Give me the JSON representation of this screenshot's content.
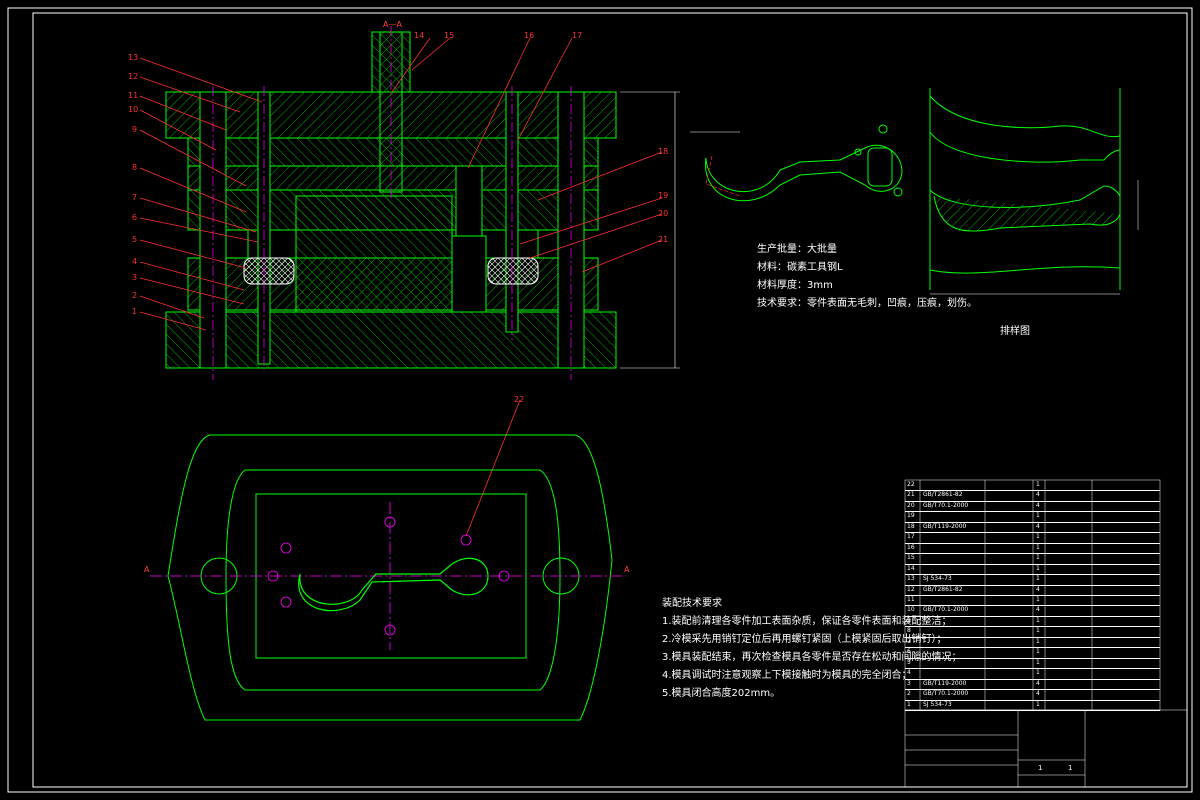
{
  "colors": {
    "background": "#000000",
    "outline": "#00ff00",
    "hatch": "#00cc00",
    "leader": "#ff2020",
    "center": "#ff00ff",
    "text": "#ffffff",
    "frame": "#ffffff"
  },
  "section_label": "A—A",
  "part_numbers": [
    "1",
    "2",
    "3",
    "4",
    "5",
    "6",
    "7",
    "8",
    "9",
    "10",
    "11",
    "12",
    "13",
    "14",
    "15",
    "16",
    "17",
    "18",
    "19",
    "20",
    "21",
    "22"
  ],
  "strip_label": "排样图",
  "spec": {
    "line1": "生产批量：大批量",
    "line2": "材料：碳素工具钢L",
    "line3": "材料厚度：3mm",
    "line4": "技术要求：零件表面无毛刺，凹痕，压痕，划伤。"
  },
  "tech_req": {
    "title": "装配技术要求",
    "items": [
      "1.装配前清理各零件加工表面杂质，保证各零件表面和装配整洁；",
      "2.冷模采先用销钉定位后再用螺钉紧固（上模紧固后取出销钉）；",
      "3.模具装配结束，再次检查模具各零件是否存在松动和间隙的情况；",
      "4.模具调试时注意观察上下模接触时为模具的完全闭合；",
      "5.模具闭合高度202mm。"
    ]
  },
  "bom_rows": [
    {
      "no": "22",
      "std": "",
      "name": "",
      "qty": "1",
      "mat": ""
    },
    {
      "no": "21",
      "std": "GB/T2861-82",
      "name": "",
      "qty": "4",
      "mat": ""
    },
    {
      "no": "20",
      "std": "GB/T70.1-2000",
      "name": "",
      "qty": "4",
      "mat": ""
    },
    {
      "no": "19",
      "std": "",
      "name": "",
      "qty": "1",
      "mat": ""
    },
    {
      "no": "18",
      "std": "GB/T119-2000",
      "name": "",
      "qty": "4",
      "mat": ""
    },
    {
      "no": "17",
      "std": "",
      "name": "",
      "qty": "1",
      "mat": ""
    },
    {
      "no": "16",
      "std": "",
      "name": "",
      "qty": "1",
      "mat": ""
    },
    {
      "no": "15",
      "std": "",
      "name": "",
      "qty": "1",
      "mat": ""
    },
    {
      "no": "14",
      "std": "",
      "name": "",
      "qty": "1",
      "mat": ""
    },
    {
      "no": "13",
      "std": "SJ 534-73",
      "name": "",
      "qty": "1",
      "mat": ""
    },
    {
      "no": "12",
      "std": "GB/T2861-82",
      "name": "",
      "qty": "4",
      "mat": ""
    },
    {
      "no": "11",
      "std": "",
      "name": "",
      "qty": "1",
      "mat": ""
    },
    {
      "no": "10",
      "std": "GB/T70.1-2000",
      "name": "",
      "qty": "4",
      "mat": ""
    },
    {
      "no": "9",
      "std": "",
      "name": "",
      "qty": "1",
      "mat": ""
    },
    {
      "no": "8",
      "std": "",
      "name": "",
      "qty": "1",
      "mat": ""
    },
    {
      "no": "7",
      "std": "",
      "name": "",
      "qty": "1",
      "mat": ""
    },
    {
      "no": "6",
      "std": "",
      "name": "",
      "qty": "1",
      "mat": ""
    },
    {
      "no": "5",
      "std": "",
      "name": "",
      "qty": "1",
      "mat": ""
    },
    {
      "no": "4",
      "std": "",
      "name": "",
      "qty": "1",
      "mat": ""
    },
    {
      "no": "3",
      "std": "GB/T119-2000",
      "name": "",
      "qty": "4",
      "mat": ""
    },
    {
      "no": "2",
      "std": "GB/T70.1-2000",
      "name": "",
      "qty": "4",
      "mat": ""
    },
    {
      "no": "1",
      "std": "SJ 534-73",
      "name": "",
      "qty": "1",
      "mat": ""
    }
  ],
  "title_block": {
    "sheet": "1",
    "sheets": "1"
  }
}
